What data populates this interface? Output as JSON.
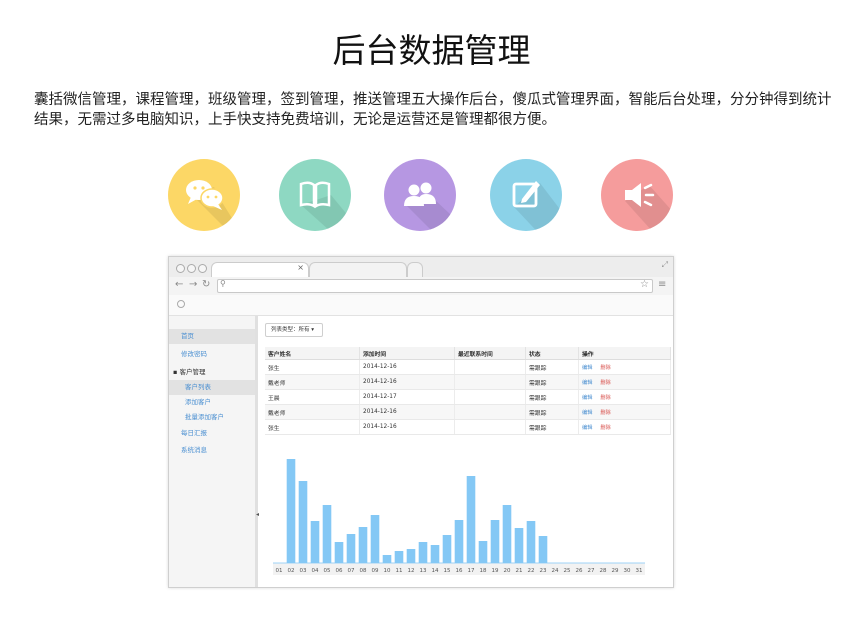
{
  "page": {
    "title": "后台数据管理",
    "description": "囊括微信管理，课程管理，班级管理，签到管理，推送管理五大操作后台，傻瓜式管理界面，智能后台处理，分分钟得到统计结果，无需过多电脑知识，上手快支持免费培训，无论是运营还是管理都很方便。"
  },
  "icons": [
    {
      "name": "wechat-icon",
      "color": "#fcd766"
    },
    {
      "name": "book-icon",
      "color": "#8ed8c2"
    },
    {
      "name": "users-icon",
      "color": "#b697e2"
    },
    {
      "name": "edit-icon",
      "color": "#8bd2e8"
    },
    {
      "name": "megaphone-icon",
      "color": "#f59c9c"
    }
  ],
  "browser": {
    "sidebar": {
      "items": [
        {
          "label": "首页",
          "active": true
        },
        {
          "label": "修改密码"
        },
        {
          "label": "▪ 客户管理",
          "group": true
        },
        {
          "label": "客户列表",
          "active": true,
          "sub": true
        },
        {
          "label": "添加客户",
          "sub": true
        },
        {
          "label": "批量添加客户",
          "sub": true
        },
        {
          "label": "每日汇报"
        },
        {
          "label": "系统消息"
        }
      ]
    },
    "filter_label": "列表类型：所有 ▾",
    "table": {
      "columns": [
        "客户姓名",
        "添加时间",
        "最近联系时间",
        "状态",
        "操作"
      ],
      "rows": [
        {
          "name": "张生",
          "added": "2014-12-16",
          "contact": "",
          "status": "需跟踪",
          "edit": "编辑",
          "del": "删除"
        },
        {
          "name": "戴老师",
          "added": "2014-12-16",
          "contact": "",
          "status": "需跟踪",
          "edit": "编辑",
          "del": "删除"
        },
        {
          "name": "王晨",
          "added": "2014-12-17",
          "contact": "",
          "status": "需跟踪",
          "edit": "编辑",
          "del": "删除"
        },
        {
          "name": "戴老师",
          "added": "2014-12-16",
          "contact": "",
          "status": "需跟踪",
          "edit": "编辑",
          "del": "删除"
        },
        {
          "name": "张生",
          "added": "2014-12-16",
          "contact": "",
          "status": "需跟踪",
          "edit": "编辑",
          "del": "删除"
        }
      ]
    }
  },
  "chart_data": {
    "type": "bar",
    "categories": [
      "01",
      "02",
      "03",
      "04",
      "05",
      "06",
      "07",
      "08",
      "09",
      "10",
      "11",
      "12",
      "13",
      "14",
      "15",
      "16",
      "17",
      "18",
      "19",
      "20",
      "21",
      "22",
      "23",
      "24",
      "25",
      "26",
      "27",
      "28",
      "29",
      "30",
      "31"
    ],
    "values": [
      0,
      104,
      82,
      42,
      58,
      21,
      29,
      36,
      48,
      8,
      12,
      14,
      21,
      18,
      28,
      43,
      87,
      22,
      43,
      58,
      35,
      42,
      27,
      0,
      0,
      0,
      0,
      0,
      0,
      0,
      0
    ],
    "ylim": [
      0,
      110
    ],
    "bar_color": "#84c8f5",
    "grid": false
  }
}
